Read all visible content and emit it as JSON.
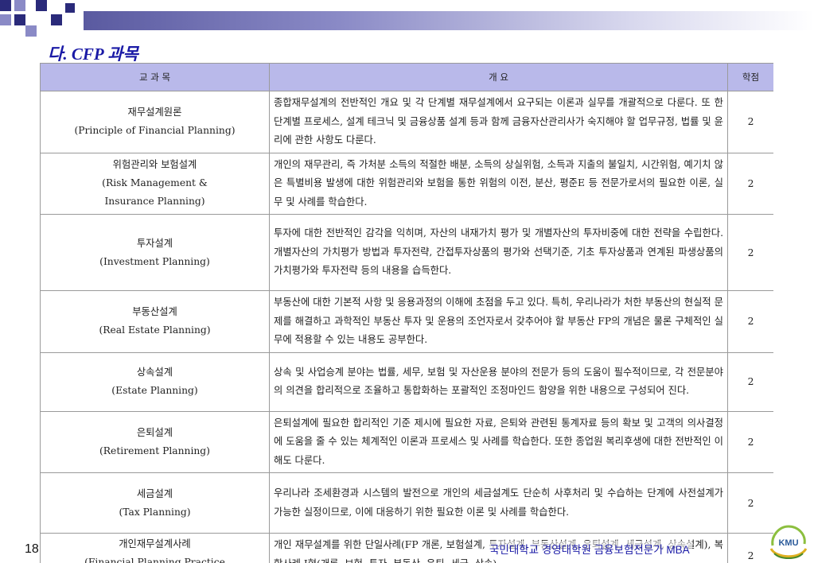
{
  "section_title": "다. CFP 과목",
  "colors": {
    "header_bg": "#b9b9ea",
    "title": "#1a1aa6",
    "accent": "#2a2a7a"
  },
  "table": {
    "headers": {
      "subject": "교 과 목",
      "overview": "개 요",
      "credit": "학점"
    },
    "rows": [
      {
        "name_ko": "재무설계원론",
        "name_en": "(Principle of Financial Planning)",
        "desc": "종합재무설계의 전반적인 개요 및 각 단계별 재무설계에서 요구되는 이론과 실무를 개괄적으로 다룬다. 또 한 단계별 프로세스, 설계 테크닉 및 금융상품 설계 등과 함께 금융자산관리사가 숙지해야 할 업무규정, 법률 및 윤리에 관한 사항도 다룬다.",
        "credit": "2"
      },
      {
        "name_ko": "위험관리와 보험설계",
        "name_en": "(Risk Management &",
        "name_en2": "Insurance Planning)",
        "desc": "개인의 재무관리, 즉 가처분 소득의 적절한 배분, 소득의 상실위험, 소득과 지출의 불일치, 시간위험, 예기치 않은 특별비용 발생에 대한 위험관리와 보험을 통한 위험의 이전, 분산, 평준E 등 전문가로서의 필요한 이론, 실무 및 사례를 학습한다.",
        "credit": "2"
      },
      {
        "name_ko": "투자설계",
        "name_en": "(Investment Planning)",
        "desc": "투자에 대한 전반적인 감각을 익히며, 자산의 내재가치 평가 및 개별자산의 투자비중에 대한 전략을 수립한다. 개별자산의 가치평가 방법과 투자전략, 간접투자상품의 평가와 선택기준, 기초 투자상품과 연계된 파생상품의 가치평가와 투자전략 등의 내용을 습득한다.",
        "credit": "2"
      },
      {
        "name_ko": "부동산설계",
        "name_en": "(Real Estate Planning)",
        "desc": "부동산에 대한 기본적 사항 및 응용과정의 이해에 초점을 두고 있다. 특히, 우리나라가 처한 부동산의 현실적 문제를 해결하고 과학적인 부동산 투자 및 운용의 조언자로서 갖추어야 할 부동산 FP의 개념은 물론 구체적인 실무에 적용할 수 있는 내용도 공부한다.",
        "credit": "2"
      },
      {
        "name_ko": "상속설계",
        "name_en": "(Estate Planning)",
        "desc": "상속 및 사업승계 분야는 법률, 세무, 보험 및 자산운용 분야의 전문가 등의 도움이 필수적이므로, 각 전문분야의 의견을 합리적으로 조율하고 통합화하는 포괄적인 조정마인드 함양을 위한 내용으로 구성되어 진다.",
        "credit": "2"
      },
      {
        "name_ko": "은퇴설계",
        "name_en": "(Retirement Planning)",
        "desc": "은퇴설계에 필요한 합리적인 기준 제시에 필요한 자료, 은퇴와 관련된 통계자료 등의 확보 및 고객의 의사결정에 도움을 줄 수 있는 체계적인 이론과 프로세스 및 사례를 학습한다. 또한 종업원 복리후생에 대한 전반적인 이해도 다룬다.",
        "credit": "2"
      },
      {
        "name_ko": "세금설계",
        "name_en": "(Tax Planning)",
        "desc": "우리나라 조세환경과 시스템의 발전으로 개인의 세금설계도 단순히 사후처리 및 수습하는 단계에 사전설계가 가능한 실정이므로, 이에 대응하기 위한 필요한 이론 및 사례를 학습한다.",
        "credit": "2"
      },
      {
        "name_ko": "개인재무설계사례",
        "name_en": "(Financial Planning Practice",
        "desc": "개인 재무설계를 위한 단일사례(FP 개론, 보험설계, 투자설계, 부동산설계, 은퇴설계, 세금설계, 상속설계), 복합사례 I형(개론, 보험, 투자, 부동산, 은퇴, 세금, 상속)",
        "credit": "2"
      }
    ]
  },
  "footer": {
    "page_number": "18",
    "text": "국민대학교 경영대학원 금융보험전문가 MBA"
  },
  "logo_text": "KMU"
}
